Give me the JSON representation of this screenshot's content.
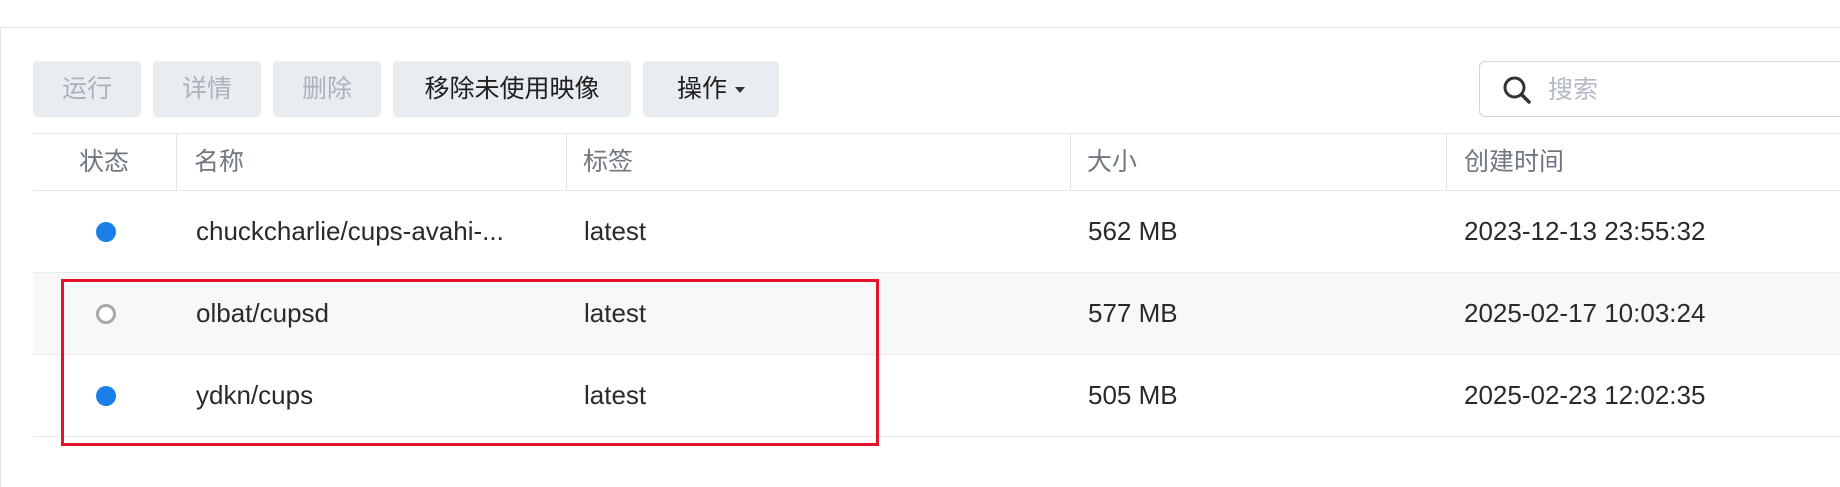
{
  "toolbar": {
    "run": "运行",
    "details": "详情",
    "delete": "删除",
    "remove_unused": "移除未使用映像",
    "actions": "操作"
  },
  "search": {
    "placeholder": "搜索"
  },
  "table": {
    "headers": {
      "status": "状态",
      "name": "名称",
      "tag": "标签",
      "size": "大小",
      "created": "创建时间"
    },
    "rows": [
      {
        "status": "running",
        "name": "chuckcharlie/cups-avahi-...",
        "tag": "latest",
        "size": "562 MB",
        "created": "2023-12-13 23:55:32"
      },
      {
        "status": "stopped",
        "name": "olbat/cupsd",
        "tag": "latest",
        "size": "577 MB",
        "created": "2025-02-17 10:03:24"
      },
      {
        "status": "running",
        "name": "ydkn/cups",
        "tag": "latest",
        "size": "505 MB",
        "created": "2025-02-23 12:02:35"
      }
    ]
  },
  "colors": {
    "running": "#1a7fe8",
    "stopped": "#a8a8a8",
    "highlight": "#e5142b"
  }
}
